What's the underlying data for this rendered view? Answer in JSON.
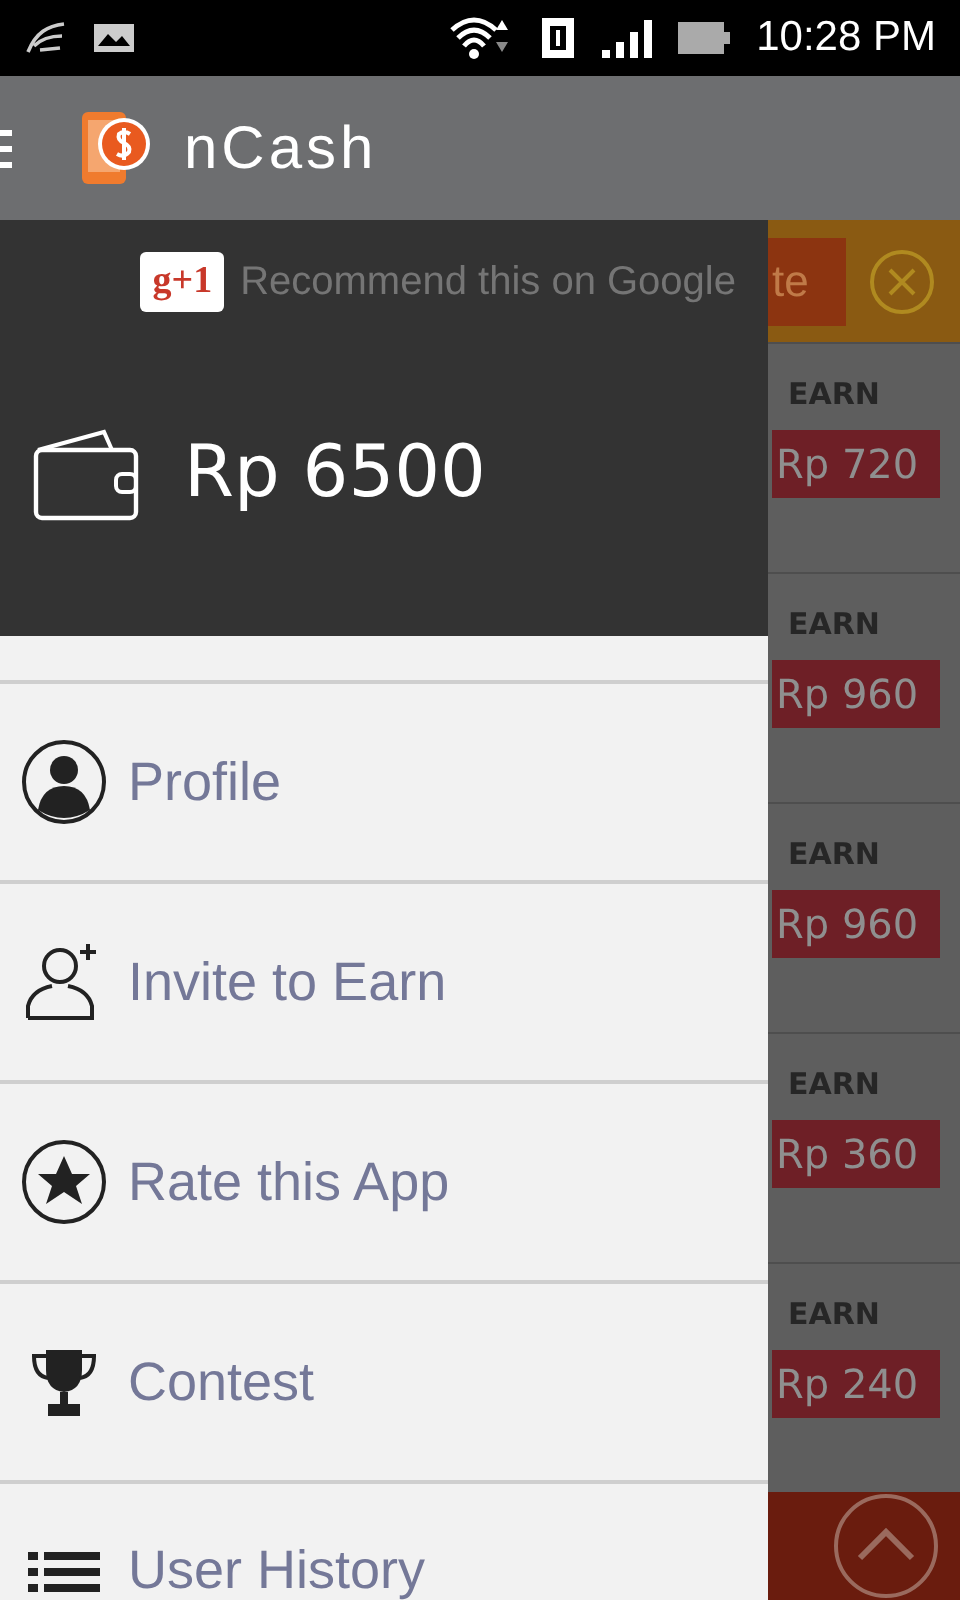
{
  "status_bar": {
    "time": "10:28 PM"
  },
  "app_bar": {
    "title": "nCash"
  },
  "background": {
    "banner_button": "te",
    "offers": [
      {
        "label": "EARN",
        "reward": "Rp 720"
      },
      {
        "label": "EARN",
        "reward": "Rp 960"
      },
      {
        "label": "EARN",
        "reward": "Rp 960"
      },
      {
        "label": "EARN",
        "reward": "Rp 360"
      },
      {
        "label": "EARN",
        "reward": "Rp 240"
      }
    ]
  },
  "drawer": {
    "google_plus": {
      "badge": "g+1",
      "label": "Recommend this on Google"
    },
    "balance": "Rp 6500",
    "items": [
      {
        "label": "Profile"
      },
      {
        "label": "Invite to Earn"
      },
      {
        "label": "Rate this App"
      },
      {
        "label": "Contest"
      },
      {
        "label": "User History"
      }
    ]
  }
}
